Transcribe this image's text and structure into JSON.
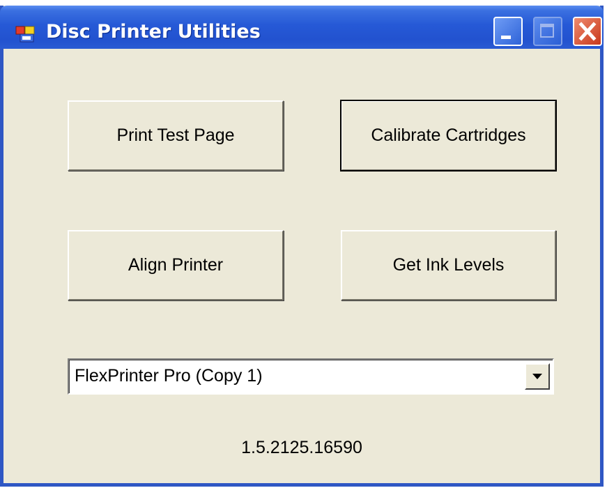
{
  "window": {
    "title": "Disc Printer Utilities",
    "icons": {
      "app": "app-window-icon",
      "minimize": "minimize-icon",
      "maximize": "maximize-icon",
      "close": "close-icon"
    }
  },
  "buttons": {
    "print_test_page": "Print Test Page",
    "calibrate_cartridges": "Calibrate Cartridges",
    "align_printer": "Align Printer",
    "get_ink_levels": "Get Ink Levels"
  },
  "printer_select": {
    "selected": "FlexPrinter Pro (Copy 1)"
  },
  "version": "1.5.2125.16590",
  "colors": {
    "titlebar": "#2659d6",
    "window_bg": "#ece9d8",
    "close_button": "#c8391c"
  }
}
